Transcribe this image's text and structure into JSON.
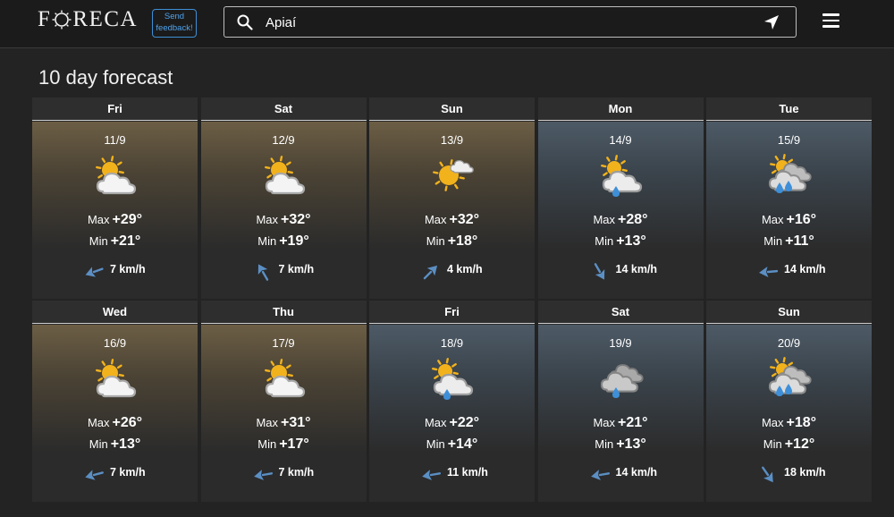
{
  "header": {
    "logo_left": "F",
    "logo_right": "RECA",
    "feedback_label": "Send feedback!",
    "search_value": "Apiaí"
  },
  "title": "10 day forecast",
  "colors": {
    "accent": "#3d8fd6",
    "wind_arrow": "#5b8fc4",
    "sun": "#f2b21c"
  },
  "days": [
    {
      "name": "Fri",
      "date": "11/9",
      "icon": "partly-cloudy-icon",
      "max": "+29°",
      "min": "+21°",
      "wind": "7 km/h",
      "wind_dir_deg": 250,
      "tone": "warm"
    },
    {
      "name": "Sat",
      "date": "12/9",
      "icon": "partly-cloudy-icon",
      "max": "+32°",
      "min": "+19°",
      "wind": "7 km/h",
      "wind_dir_deg": 330,
      "tone": "warm"
    },
    {
      "name": "Sun",
      "date": "13/9",
      "icon": "mostly-sunny-icon",
      "max": "+32°",
      "min": "+18°",
      "wind": "4 km/h",
      "wind_dir_deg": 45,
      "tone": "warm"
    },
    {
      "name": "Mon",
      "date": "14/9",
      "icon": "partly-cloudy-rain-icon",
      "max": "+28°",
      "min": "+13°",
      "wind": "14 km/h",
      "wind_dir_deg": 150,
      "tone": "cool"
    },
    {
      "name": "Tue",
      "date": "15/9",
      "icon": "cloudy-showers-icon",
      "max": "+16°",
      "min": "+11°",
      "wind": "14 km/h",
      "wind_dir_deg": 265,
      "tone": "cool"
    },
    {
      "name": "Wed",
      "date": "16/9",
      "icon": "partly-cloudy-icon",
      "max": "+26°",
      "min": "+13°",
      "wind": "7 km/h",
      "wind_dir_deg": 255,
      "tone": "warm"
    },
    {
      "name": "Thu",
      "date": "17/9",
      "icon": "partly-cloudy-icon",
      "max": "+31°",
      "min": "+17°",
      "wind": "7 km/h",
      "wind_dir_deg": 260,
      "tone": "warm"
    },
    {
      "name": "Fri",
      "date": "18/9",
      "icon": "partly-cloudy-rain-icon",
      "max": "+22°",
      "min": "+14°",
      "wind": "11 km/h",
      "wind_dir_deg": 260,
      "tone": "cool"
    },
    {
      "name": "Sat",
      "date": "19/9",
      "icon": "cloudy-rain-icon",
      "max": "+21°",
      "min": "+13°",
      "wind": "14 km/h",
      "wind_dir_deg": 260,
      "tone": "cool"
    },
    {
      "name": "Sun",
      "date": "20/9",
      "icon": "cloudy-showers-icon",
      "max": "+18°",
      "min": "+12°",
      "wind": "18 km/h",
      "wind_dir_deg": 145,
      "tone": "cool"
    }
  ],
  "labels": {
    "max": "Max",
    "min": "Min"
  }
}
